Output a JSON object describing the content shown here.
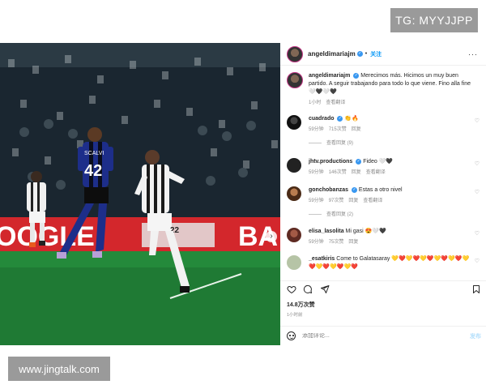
{
  "watermarks": {
    "top": "TG: MYYJJPP",
    "bottom": "www.jingtalk.com"
  },
  "photo": {
    "banner_left": "OOGLE",
    "banner_right": "BA",
    "player_left_number": "42",
    "player_left_sponsor": "SCALVI",
    "player_center_number": "22",
    "carousel_count": 5,
    "carousel_active": 1
  },
  "header": {
    "username": "angeldimariajm",
    "follow": "关注",
    "more": "···"
  },
  "caption": {
    "username": "angeldimariajm",
    "text": "Merecimos más. Hicimos un muy buen partido. A seguir trabajando para todo lo que viene. Fino alla fine 🤍🖤🤍🖤",
    "time": "1小时",
    "translate": "查看翻译"
  },
  "comments": [
    {
      "username": "cuadrado",
      "text": "👏🔥",
      "time": "59分钟",
      "likes": "715次赞",
      "reply": "回复",
      "view_replies": "查看回复 (9)"
    },
    {
      "username": "jhtv.productions",
      "text": "Fideo 🤍🖤",
      "time": "59分钟",
      "likes": "146次赞",
      "reply": "回复",
      "translate": "查看翻译"
    },
    {
      "username": "gonchobanzas",
      "text": "Estas a otro nivel",
      "time": "59分钟",
      "likes": "97次赞",
      "reply": "回复",
      "translate": "查看翻译",
      "view_replies": "查看回复 (2)"
    },
    {
      "username": "elisa_lasolita",
      "text": "Mi gasi 😍🤍🖤",
      "time": "59分钟",
      "likes": "75次赞",
      "reply": "回复"
    },
    {
      "username": "_esatkiris",
      "text": "Come to Galatasaray 💛❤️💛❤️💛❤️💛❤️💛❤️💛❤️💛❤️💛❤️💛❤️"
    }
  ],
  "stats": {
    "likes": "14.8万次赞",
    "time": "1小时前"
  },
  "comment_box": {
    "placeholder": "添加评论...",
    "post": "发布"
  },
  "icons": [
    "heart-icon",
    "comment-icon",
    "share-icon",
    "bookmark-icon",
    "emoji-icon",
    "verified-icon",
    "more-icon",
    "chevron-right-icon",
    "user-tag-icon"
  ],
  "colors": {
    "link_blue": "#0095f6",
    "verified_blue": "#3897f0",
    "muted_text": "#8e8e8e",
    "pitch_green": "#1f7a34",
    "banner_red": "#d3272c"
  }
}
